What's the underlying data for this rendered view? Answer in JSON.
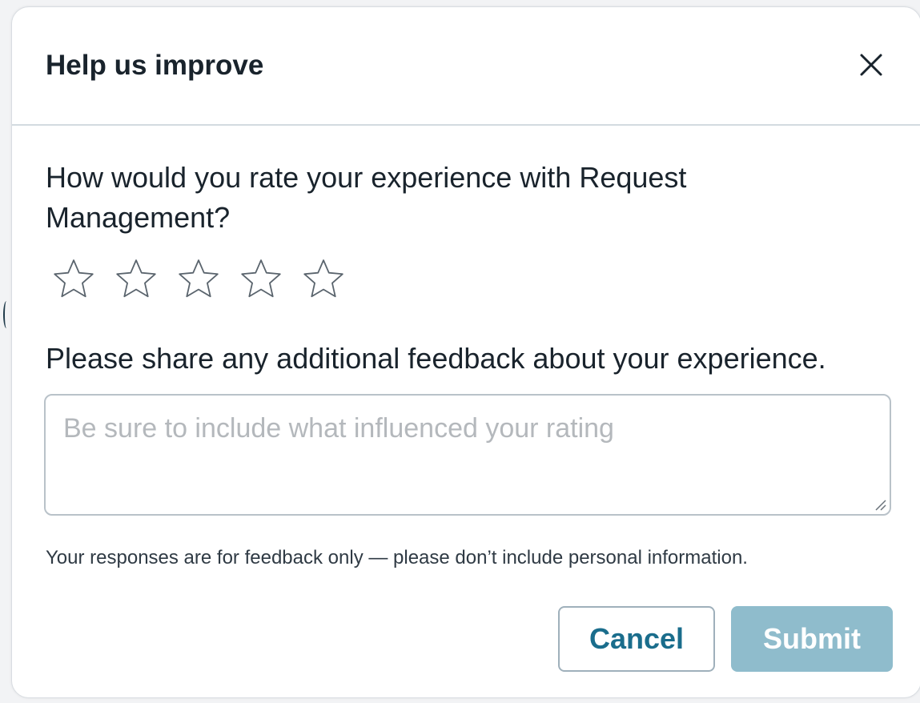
{
  "dialog": {
    "title": "Help us improve",
    "close_icon": "close-icon"
  },
  "rating": {
    "question": "How would you rate your experience with Request Management?",
    "max_stars": 5,
    "current_rating": 0,
    "star_icon": "star-outline-icon"
  },
  "feedback": {
    "label": "Please share any additional feedback about your experience.",
    "placeholder": "Be sure to include what influenced your rating",
    "value": ""
  },
  "disclaimer": "Your responses are for feedback only — please don’t include personal information.",
  "actions": {
    "cancel_label": "Cancel",
    "submit_label": "Submit"
  },
  "colors": {
    "primary_text": "#19232c",
    "accent": "#1a6d8c",
    "submit_disabled_bg": "#8fbccc",
    "placeholder": "#b4b8bc"
  }
}
